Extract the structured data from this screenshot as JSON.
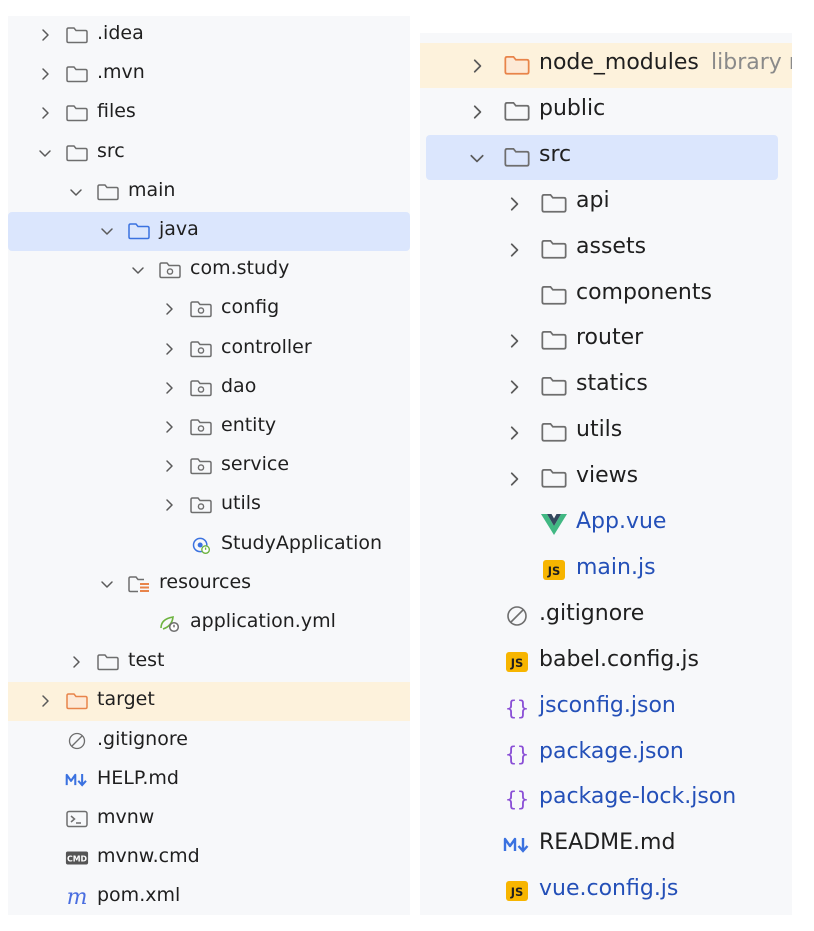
{
  "left_tree": {
    "items": [
      {
        "label": ".idea",
        "icon": "folder-icon",
        "depth": 0,
        "chevron": "right"
      },
      {
        "label": ".mvn",
        "icon": "folder-icon",
        "depth": 0,
        "chevron": "right"
      },
      {
        "label": "files",
        "icon": "folder-icon",
        "depth": 0,
        "chevron": "right"
      },
      {
        "label": "src",
        "icon": "folder-icon",
        "depth": 0,
        "chevron": "down"
      },
      {
        "label": "main",
        "icon": "folder-icon",
        "depth": 1,
        "chevron": "down"
      },
      {
        "label": "java",
        "icon": "source-folder-icon",
        "depth": 2,
        "chevron": "down",
        "selected": true
      },
      {
        "label": "com.study",
        "icon": "package-icon",
        "depth": 3,
        "chevron": "down"
      },
      {
        "label": "config",
        "icon": "package-icon",
        "depth": 4,
        "chevron": "right"
      },
      {
        "label": "controller",
        "icon": "package-icon",
        "depth": 4,
        "chevron": "right"
      },
      {
        "label": "dao",
        "icon": "package-icon",
        "depth": 4,
        "chevron": "right"
      },
      {
        "label": "entity",
        "icon": "package-icon",
        "depth": 4,
        "chevron": "right"
      },
      {
        "label": "service",
        "icon": "package-icon",
        "depth": 4,
        "chevron": "right"
      },
      {
        "label": "utils",
        "icon": "package-icon",
        "depth": 4,
        "chevron": "right"
      },
      {
        "label": "StudyApplication",
        "icon": "spring-boot-app-icon",
        "depth": 4,
        "chevron": "none"
      },
      {
        "label": "resources",
        "icon": "resources-folder-icon",
        "depth": 2,
        "chevron": "down"
      },
      {
        "label": "application.yml",
        "icon": "spring-config-icon",
        "depth": 3,
        "chevron": "none"
      },
      {
        "label": "test",
        "icon": "folder-icon",
        "depth": 1,
        "chevron": "right"
      },
      {
        "label": "target",
        "icon": "excluded-folder-icon",
        "depth": 0,
        "chevron": "right",
        "excluded": true
      },
      {
        "label": ".gitignore",
        "icon": "gitignore-icon",
        "depth": 0,
        "chevron": "none"
      },
      {
        "label": "HELP.md",
        "icon": "markdown-icon",
        "depth": 0,
        "chevron": "none"
      },
      {
        "label": "mvnw",
        "icon": "shell-script-icon",
        "depth": 0,
        "chevron": "none"
      },
      {
        "label": "mvnw.cmd",
        "icon": "cmd-file-icon",
        "depth": 0,
        "chevron": "none"
      },
      {
        "label": "pom.xml",
        "icon": "maven-icon",
        "depth": 0,
        "chevron": "none"
      }
    ]
  },
  "right_tree": {
    "items": [
      {
        "label": "node_modules",
        "hint": "library r",
        "icon": "excluded-folder-icon",
        "depth": 0,
        "chevron": "right",
        "excluded": true
      },
      {
        "label": "public",
        "icon": "folder-icon",
        "depth": 0,
        "chevron": "right"
      },
      {
        "label": "src",
        "icon": "folder-icon",
        "depth": 0,
        "chevron": "down",
        "selected": true
      },
      {
        "label": "api",
        "icon": "folder-icon",
        "depth": 1,
        "chevron": "right"
      },
      {
        "label": "assets",
        "icon": "folder-icon",
        "depth": 1,
        "chevron": "right"
      },
      {
        "label": "components",
        "icon": "folder-icon",
        "depth": 1,
        "chevron": "none"
      },
      {
        "label": "router",
        "icon": "folder-icon",
        "depth": 1,
        "chevron": "right"
      },
      {
        "label": "statics",
        "icon": "folder-icon",
        "depth": 1,
        "chevron": "right"
      },
      {
        "label": "utils",
        "icon": "folder-icon",
        "depth": 1,
        "chevron": "right"
      },
      {
        "label": "views",
        "icon": "folder-icon",
        "depth": 1,
        "chevron": "right"
      },
      {
        "label": "App.vue",
        "icon": "vue-icon",
        "depth": 1,
        "chevron": "none",
        "modified": true
      },
      {
        "label": "main.js",
        "icon": "javascript-icon",
        "depth": 1,
        "chevron": "none",
        "modified": true
      },
      {
        "label": ".gitignore",
        "icon": "gitignore-icon",
        "depth": 0,
        "chevron": "none"
      },
      {
        "label": "babel.config.js",
        "icon": "javascript-icon",
        "depth": 0,
        "chevron": "none"
      },
      {
        "label": "jsconfig.json",
        "icon": "json-icon",
        "depth": 0,
        "chevron": "none",
        "modified": true
      },
      {
        "label": "package.json",
        "icon": "json-icon",
        "depth": 0,
        "chevron": "none",
        "modified": true
      },
      {
        "label": "package-lock.json",
        "icon": "json-icon",
        "depth": 0,
        "chevron": "none",
        "modified": true
      },
      {
        "label": "README.md",
        "icon": "markdown-icon",
        "depth": 0,
        "chevron": "none"
      },
      {
        "label": "vue.config.js",
        "icon": "javascript-icon",
        "depth": 0,
        "chevron": "none",
        "modified": true
      }
    ]
  },
  "colors": {
    "panel_bg": "#f7f8fa",
    "selected_bg": "#dbe6fd",
    "excluded_bg": "#fdf2dc",
    "modified_text": "#2450b8",
    "excluded_folder": "#e8844a",
    "source_folder": "#3b72e0",
    "vue_green": "#41b883",
    "vue_dark": "#34495e",
    "js_badge": "#f7b500",
    "json_brace": "#8a4fd6",
    "markdown_blue": "#3b72e0",
    "maven_blue": "#4a6ee0",
    "spring_green": "#6db33f"
  }
}
